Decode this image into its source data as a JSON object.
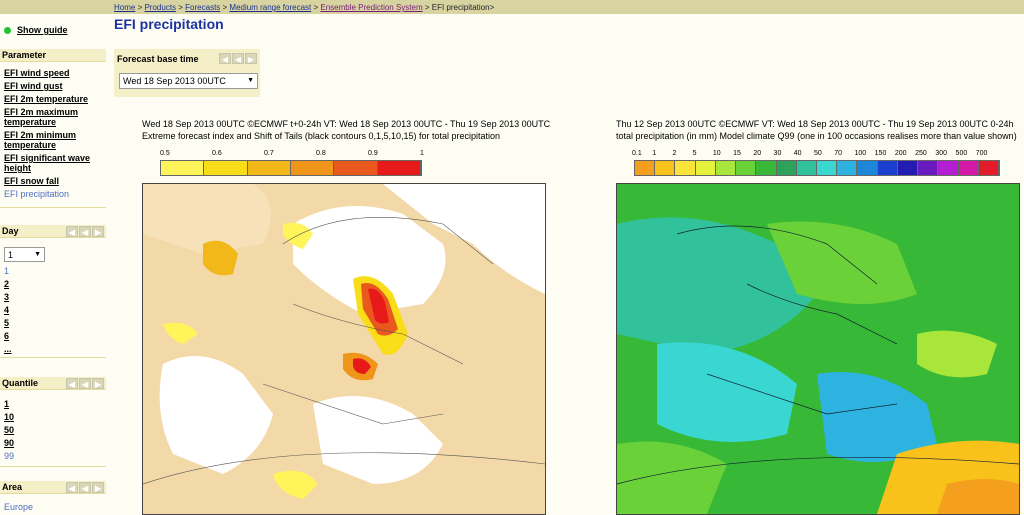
{
  "breadcrumb": {
    "items": [
      "Home",
      "Products",
      "Forecasts",
      "Medium range forecast",
      "Ensemble Prediction System"
    ],
    "current": "EFI precipitation>"
  },
  "sidebar": {
    "guide_label": "Show guide",
    "parameter": {
      "title": "Parameter",
      "items": [
        "EFI wind speed",
        "EFI wind gust",
        "EFI 2m temperature",
        "EFI 2m maximum temperature",
        "EFI 2m minimum temperature",
        "EFI significant wave height",
        "EFI snow fall",
        "EFI precipitation"
      ]
    },
    "day": {
      "title": "Day",
      "selected": "1",
      "items": [
        "1",
        "2",
        "3",
        "4",
        "5",
        "6",
        "..."
      ]
    },
    "quantile": {
      "title": "Quantile",
      "items": [
        "1",
        "10",
        "50",
        "90",
        "99"
      ]
    },
    "area": {
      "title": "Area",
      "items": [
        "Europe"
      ]
    }
  },
  "page": {
    "title": "EFI precipitation",
    "base_time_label": "Forecast base time",
    "base_time_value": "Wed 18 Sep 2013 00UTC"
  },
  "left_map": {
    "line1": "Wed 18 Sep 2013 00UTC ©ECMWF t+0-24h  VT: Wed 18 Sep 2013 00UTC - Thu 19 Sep 2013 00UTC",
    "line2": "Extreme forecast index and Shift of Tails (black contours 0,1,5,10,15) for total precipitation",
    "scale_labels": [
      "0.5",
      "0.6",
      "0.7",
      "0.8",
      "0.9",
      "1"
    ],
    "scale_colors": [
      "#fff45a",
      "#f9dd19",
      "#f2b81a",
      "#ef951a",
      "#e9581c",
      "#e81919"
    ]
  },
  "right_map": {
    "line1": "Thu 12 Sep 2013 00UTC ©ECMWF VT: Wed 18 Sep 2013 00UTC - Thu 19 Sep 2013 00UTC  0-24h",
    "line2": "total precipitation (in mm)  Model climate Q99 (one in 100 occasions realises more than value shown)",
    "scale_labels": [
      "0.1",
      "1",
      "2",
      "5",
      "10",
      "15",
      "20",
      "30",
      "40",
      "50",
      "70",
      "100",
      "150",
      "200",
      "250",
      "300",
      "500",
      "700"
    ],
    "scale_colors": [
      "#f49f1d",
      "#f9c21a",
      "#fbe43a",
      "#e7f23a",
      "#a8e63b",
      "#6ad139",
      "#37b836",
      "#2ea25a",
      "#31c29c",
      "#3ad6d2",
      "#2eb3e0",
      "#1d86d8",
      "#1d3fd0",
      "#241bb3",
      "#6a1bc0",
      "#b31ed0",
      "#d419a6",
      "#e41b2a"
    ]
  }
}
